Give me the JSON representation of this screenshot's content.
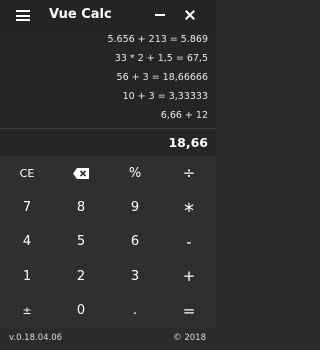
{
  "app": {
    "title": "Vue Calc",
    "menu_icon": "hamburger-menu-icon",
    "minimize_icon": "minimize-icon",
    "close_icon": "close-icon"
  },
  "history": [
    "5.656 + 213 = 5.869",
    "33 * 2 + 1,5 = 67,5",
    "56 + 3 = 18,66666",
    "10 + 3 = 3,33333",
    "6,66 + 12"
  ],
  "result": "18,66",
  "keys": {
    "ce": "CE",
    "backspace_icon": "backspace-icon",
    "percent": "%",
    "divide": "÷",
    "seven": "7",
    "eight": "8",
    "nine": "9",
    "multiply": "*",
    "four": "4",
    "five": "5",
    "six": "6",
    "minus": "-",
    "one": "1",
    "two": "2",
    "three": "3",
    "plus": "+",
    "plus_minus": "±",
    "zero": "0",
    "decimal": ".",
    "equals": "="
  },
  "footer": {
    "version": "v.0.18.04.06",
    "copyright": "© 2018"
  }
}
